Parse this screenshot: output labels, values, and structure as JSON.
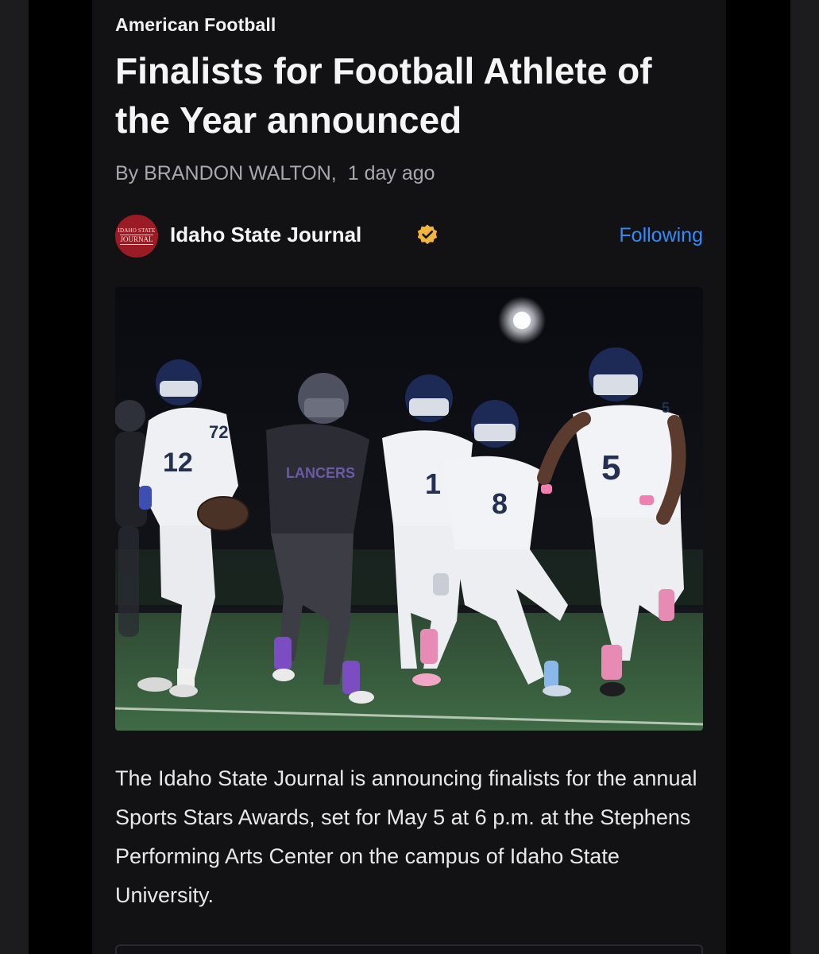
{
  "article": {
    "category": "American Football",
    "headline": "Finalists for Football Athlete of the Year announced",
    "byline": {
      "author": "By BRANDON WALTON,",
      "time": "1 day ago"
    },
    "source": {
      "name": "Idaho State Journal",
      "logo_line1": "IDAHO STATE",
      "logo_line2": "JOURNAL",
      "verified_icon": "verified-badge-icon",
      "follow_label": "Following"
    },
    "photo": {
      "subject": "football-game-photo",
      "jersey_numbers": [
        "72",
        "12",
        "1",
        "8",
        "5",
        "5",
        "12"
      ]
    },
    "body": "The Idaho State Journal is announcing finalists for the annual Sports Stars Awards, set for May 5 at 6 p.m. at the Stephens Performing Arts Center on the campus of Idaho State University."
  },
  "colors": {
    "background": "#000000",
    "card": "#121214",
    "accent_link": "#2f8cff",
    "logo_red": "#9b1b24",
    "verified_gold": "#f4b63a"
  }
}
